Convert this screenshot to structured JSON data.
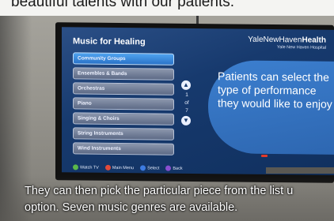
{
  "top_caption": "beautiful talents with our patients.",
  "tv": {
    "menu_title": "Music for Healing",
    "menu_items": [
      "Community Groups",
      "Ensembles & Bands",
      "Orchestras",
      "Piano",
      "Singing & Choirs",
      "String Instruments",
      "Wind Instruments"
    ],
    "page_indicator": [
      "1",
      "of",
      "7"
    ],
    "brand_name_regular": "YaleNewHaven",
    "brand_name_bold": "Health",
    "brand_sub": "Yale New Haven Hospital",
    "hint": "Patients can select the type of performance they would like to enjoy",
    "footer": [
      {
        "label": "Watch TV",
        "color": "#5bb84a"
      },
      {
        "label": "Main Menu",
        "color": "#e04a3a"
      },
      {
        "label": "Select",
        "color": "#3d7be0"
      },
      {
        "label": "Back",
        "color": "#8a4fd0"
      }
    ]
  },
  "subtitle": "They can then pick the particular piece from the list u\noption. Seven music genres are available."
}
